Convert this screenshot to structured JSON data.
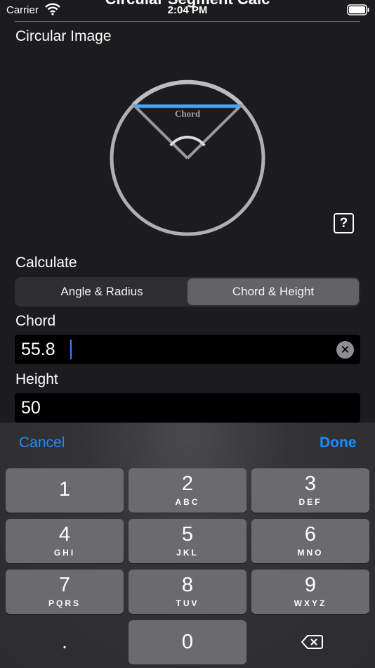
{
  "status_bar": {
    "carrier": "Carrier",
    "time": "2:04 PM"
  },
  "nav": {
    "title": "Circular Segment Calc"
  },
  "image_section": {
    "title": "Circular Image",
    "diagram_label": "Chord",
    "help_label": "?"
  },
  "calculate": {
    "title": "Calculate",
    "options": [
      "Angle & Radius",
      "Chord & Height"
    ],
    "selected": "Chord & Height"
  },
  "chord": {
    "label": "Chord",
    "value": "55.8"
  },
  "height": {
    "label": "Height",
    "value": "50"
  },
  "keyboard_toolbar": {
    "cancel": "Cancel",
    "done": "Done"
  },
  "keypad": {
    "rows": [
      [
        {
          "num": "1",
          "sub": ""
        },
        {
          "num": "2",
          "sub": "ABC"
        },
        {
          "num": "3",
          "sub": "DEF"
        }
      ],
      [
        {
          "num": "4",
          "sub": "GHI"
        },
        {
          "num": "5",
          "sub": "JKL"
        },
        {
          "num": "6",
          "sub": "MNO"
        }
      ],
      [
        {
          "num": "7",
          "sub": "PQRS"
        },
        {
          "num": "8",
          "sub": "TUV"
        },
        {
          "num": "9",
          "sub": "WXYZ"
        }
      ],
      [
        {
          "num": "."
        },
        {
          "num": "0"
        }
      ]
    ]
  },
  "colors": {
    "accent": "#1a8cff",
    "chord_line": "#47a8f2",
    "circle": "#b0b0b3",
    "background": "#1c1c1e"
  }
}
